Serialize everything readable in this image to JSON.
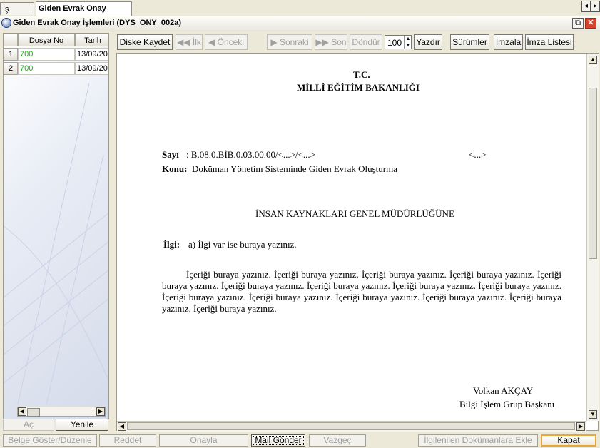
{
  "tabs": [
    {
      "label": "İş Listesi"
    },
    {
      "label": "Giden Evrak Onay İşlemleri"
    }
  ],
  "window": {
    "title": "Giden Evrak Onay İşlemleri (DYS_ONY_002a)",
    "restore_glyph": "⧉",
    "close_glyph": "✕"
  },
  "grid": {
    "columns": [
      "Dosya No",
      "Tarih"
    ],
    "rows": [
      {
        "num": "1",
        "dosya_no": "700",
        "tarih": "13/09/20"
      },
      {
        "num": "2",
        "dosya_no": "700",
        "tarih": "13/09/20"
      }
    ],
    "value_color": "#1fa81f"
  },
  "left_buttons": {
    "ac": "Aç",
    "yenile": "Yenile"
  },
  "toolbar": {
    "diske_kaydet": "Diske Kaydet",
    "ilk": "İlk",
    "onceki": "Önceki",
    "sonraki": "Sonraki",
    "son": "Son",
    "dondur": "Döndür",
    "zoom": "100",
    "yazdir": "Yazdır",
    "surumler": "Sürümler",
    "imzala": "İmzala",
    "imza_listesi": "İmza Listesi"
  },
  "document": {
    "header1": "T.C.",
    "header2": "MİLLİ EĞİTİM BAKANLIĞI",
    "sayi_label": "Sayı",
    "sayi_value": ": B.08.0.BİB.0.03.00.00/<...>/<...>",
    "sayi_date": "<...>",
    "konu_label": "Konu:",
    "konu_value": "Doküman Yönetim Sisteminde Giden Evrak Oluşturma",
    "recipient": "İNSAN KAYNAKLARI GENEL MÜDÜRLÜĞÜNE",
    "ilgi_label": "İlgi:",
    "ilgi_value": "a) İlgi var ise buraya yazınız.",
    "body": "İçeriği buraya yazınız. İçeriği buraya yazınız. İçeriği buraya yazınız. İçeriği buraya yazınız. İçeriği buraya yazınız. İçeriği buraya yazınız. İçeriği buraya yazınız. İçeriği buraya yazınız. İçeriği buraya yazınız. İçeriği buraya yazınız. İçeriği buraya yazınız. İçeriği buraya yazınız. İçeriği buraya yazınız. İçeriği buraya yazınız. İçeriği buraya yazınız.",
    "signer_name": "Volkan AKÇAY",
    "signer_title": "Bilgi İşlem Grup Başkanı"
  },
  "bottom_bar": {
    "belge_goster": "Belge Göster/Düzenle",
    "reddet": "Reddet",
    "onayla": "Onayla",
    "mail_gonder": "Mail Gönder",
    "vazgec": "Vazgeç",
    "ilgilenilen": "İlgilenilen Dokümanlara Ekle",
    "kapat": "Kapat"
  }
}
